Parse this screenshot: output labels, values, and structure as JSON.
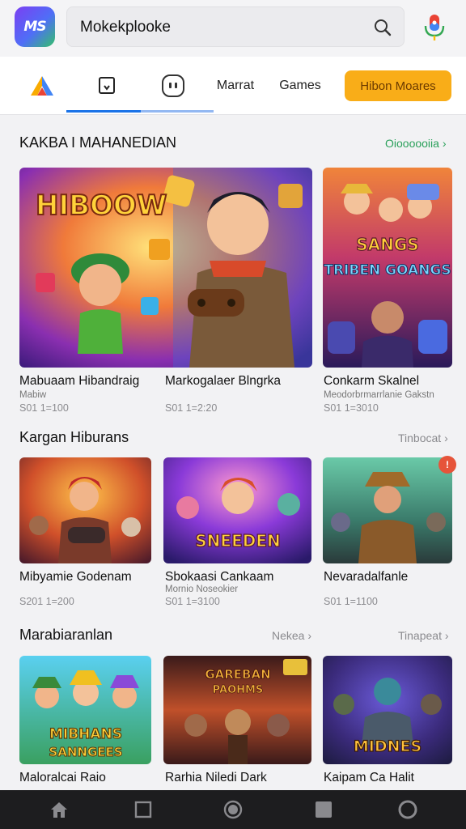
{
  "header": {
    "logo_text": "MS",
    "search_value": "Mokekplooke",
    "icons": [
      "search-icon",
      "mic-icon"
    ]
  },
  "tabs": {
    "items": [
      {
        "icon": "brand-triangle-icon"
      },
      {
        "icon": "bookmark-icon"
      },
      {
        "icon": "console-icon"
      },
      {
        "label": "Marrat"
      },
      {
        "label": "Games"
      }
    ],
    "cta_label": "Hibon Moares"
  },
  "sections": [
    {
      "title": "KAKBA I MAHANEDIAN",
      "link": "Oioooooiia ›",
      "cards": [
        {
          "title": "Mabuaam Hibandraig",
          "subtitle": "Mabiw",
          "meta": "S01 1=100"
        },
        {
          "title": "Markogalaer Blngrka",
          "subtitle": "",
          "meta": "S01 1=2:20"
        },
        {
          "title": "Conkarm Skalnel",
          "subtitle": "Meodorbrmarrlanie Gakstn",
          "meta": "S01 1=3010"
        }
      ]
    },
    {
      "title": "Kargan Hiburans",
      "link": "Tinbocat ›",
      "cards": [
        {
          "title": "Mibyamie Godenam",
          "subtitle": "",
          "meta": "S201 1=200"
        },
        {
          "title": "Sbokaasi Cankaam",
          "subtitle": "Mornio Noseokier",
          "meta": "S01 1=3100"
        },
        {
          "title": "Nevaradalfanle",
          "subtitle": "",
          "meta": "S01 1=1100"
        }
      ]
    },
    {
      "title": "Marabiaranlan",
      "link": "Nekea ›",
      "link2": "Tinapeat ›",
      "cards": [
        {
          "title": "Maloralcai Raio"
        },
        {
          "title": "Rarhia Niledi Dark"
        },
        {
          "title": "Kaipam Ca Halit"
        }
      ]
    }
  ],
  "art_text": {
    "hero": "HIBOOW",
    "side": "SANGS TRIBEN GOANGS",
    "row2_mid": "SNEEDEN",
    "row3_left": "MIBHANS SANNGEES",
    "row3_mid": "GAREBAN PAOHMS",
    "row3_right": "MIDNES"
  },
  "badge": "",
  "navbar": {
    "items": [
      "home-icon",
      "square-icon",
      "circle-icon",
      "stop-icon",
      "ring-icon"
    ]
  },
  "colors": {
    "accent": "#1a73e8",
    "cta": "#f9ad18",
    "green_link": "#2aa05a",
    "navbar": "#1d1d1f"
  }
}
